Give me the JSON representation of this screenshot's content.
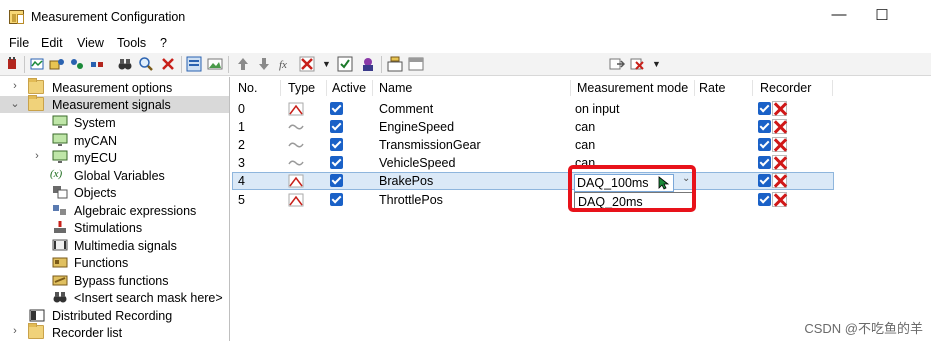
{
  "window": {
    "title": "Measurement Configuration",
    "minimize_glyph": "—",
    "maximize_glyph": "☐"
  },
  "menu": [
    "File",
    "Edit",
    "View",
    "Tools",
    "?"
  ],
  "toolbar_icons": [
    "power-plug-icon",
    "add-signal-icon",
    "add-group-icon",
    "add-multiple-icon",
    "binoculars-icon",
    "search-icon",
    "delete-icon",
    "view-mode-icon",
    "picture-icon",
    "move-up-icon",
    "move-down-icon",
    "function-icon",
    "disable-icon",
    "activate-icon",
    "recorder-icon",
    "insert-icon",
    "table-icon",
    "export-icon",
    "import-icon"
  ],
  "tree": {
    "items": [
      {
        "label": "Measurement options",
        "icon": "folder-icon",
        "expander": "›"
      },
      {
        "label": "Measurement signals",
        "icon": "folder-icon",
        "expander": "⌄"
      },
      {
        "label": "System",
        "icon": "monitor-icon"
      },
      {
        "label": "myCAN",
        "icon": "monitor-icon"
      },
      {
        "label": "myECU",
        "icon": "monitor-icon",
        "expander": "›"
      },
      {
        "label": "Global Variables",
        "icon": "variable-icon",
        "icon_text": "(x)"
      },
      {
        "label": "Objects",
        "icon": "objects-icon"
      },
      {
        "label": "Algebraic expressions",
        "icon": "algebra-icon"
      },
      {
        "label": "Stimulations",
        "icon": "stimulation-icon"
      },
      {
        "label": "Multimedia signals",
        "icon": "multimedia-icon"
      },
      {
        "label": "Functions",
        "icon": "functions-icon"
      },
      {
        "label": "Bypass functions",
        "icon": "bypass-icon"
      },
      {
        "label": "<Insert search mask here>",
        "icon": "binoculars-icon"
      },
      {
        "label": "Distributed Recording",
        "icon": "recording-icon"
      },
      {
        "label": "Recorder list",
        "icon": "folder-icon",
        "expander": "›"
      }
    ]
  },
  "grid": {
    "headers": {
      "no": "No.",
      "type": "Type",
      "active": "Active",
      "name": "Name",
      "mode": "Measurement mode",
      "rate": "Rate",
      "recorder": "Recorder"
    },
    "rows": [
      {
        "no": "0",
        "type": "ramp",
        "name": "Comment",
        "mode": "on input"
      },
      {
        "no": "1",
        "type": "wave",
        "name": "EngineSpeed",
        "mode": "can"
      },
      {
        "no": "2",
        "type": "wave",
        "name": "TransmissionGear",
        "mode": "can"
      },
      {
        "no": "3",
        "type": "wave",
        "name": "VehicleSpeed",
        "mode": "can"
      },
      {
        "no": "4",
        "type": "ramp",
        "name": "BrakePos",
        "mode": ""
      },
      {
        "no": "5",
        "type": "ramp",
        "name": "ThrottlePos",
        "mode": ""
      }
    ],
    "dropdown": {
      "selected": "DAQ_100ms",
      "options": [
        "DAQ_20ms"
      ],
      "caret": "⌄"
    }
  },
  "watermark": "CSDN @不吃鱼的羊",
  "colors": {
    "selection": "#dbe9f7",
    "highlight": "#e8121a",
    "checkbox": "#1a61c7"
  }
}
